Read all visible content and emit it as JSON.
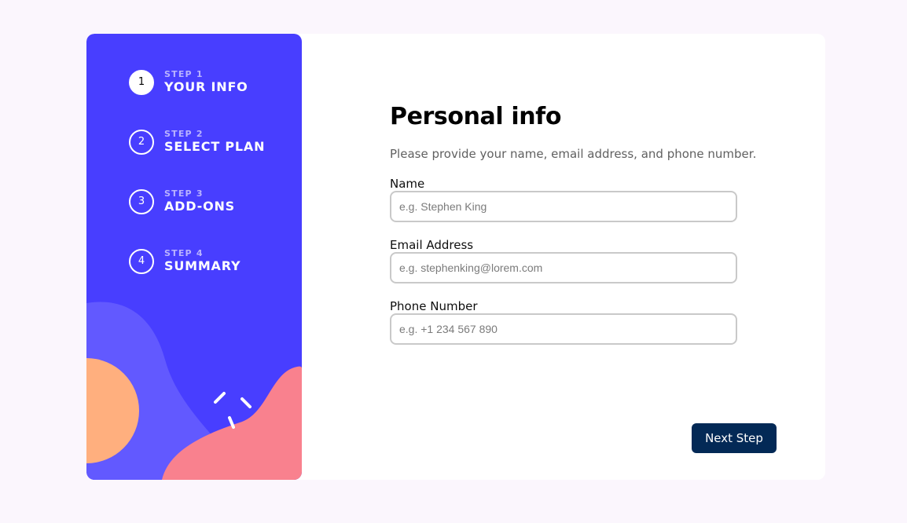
{
  "steps": [
    {
      "number": "1",
      "caption": "STEP 1",
      "title": "YOUR INFO",
      "active": true
    },
    {
      "number": "2",
      "caption": "STEP 2",
      "title": "SELECT PLAN",
      "active": false
    },
    {
      "number": "3",
      "caption": "STEP 3",
      "title": "ADD-ONS",
      "active": false
    },
    {
      "number": "4",
      "caption": "STEP 4",
      "title": "SUMMARY",
      "active": false
    }
  ],
  "form": {
    "heading": "Personal info",
    "subtitle": "Please provide your name, email address, and phone number.",
    "fields": {
      "name": {
        "label": "Name",
        "placeholder": "e.g. Stephen King",
        "value": ""
      },
      "email": {
        "label": "Email Address",
        "placeholder": "e.g. stephenking@lorem.com",
        "value": ""
      },
      "phone": {
        "label": "Phone Number",
        "placeholder": "e.g. +1 234 567 890",
        "value": ""
      }
    },
    "next_label": "Next Step"
  },
  "colors": {
    "sidebar": "#483eff",
    "accent_dark": "#032956",
    "step_caption": "#b9b3ff",
    "page_background": "#fbf6fd"
  }
}
